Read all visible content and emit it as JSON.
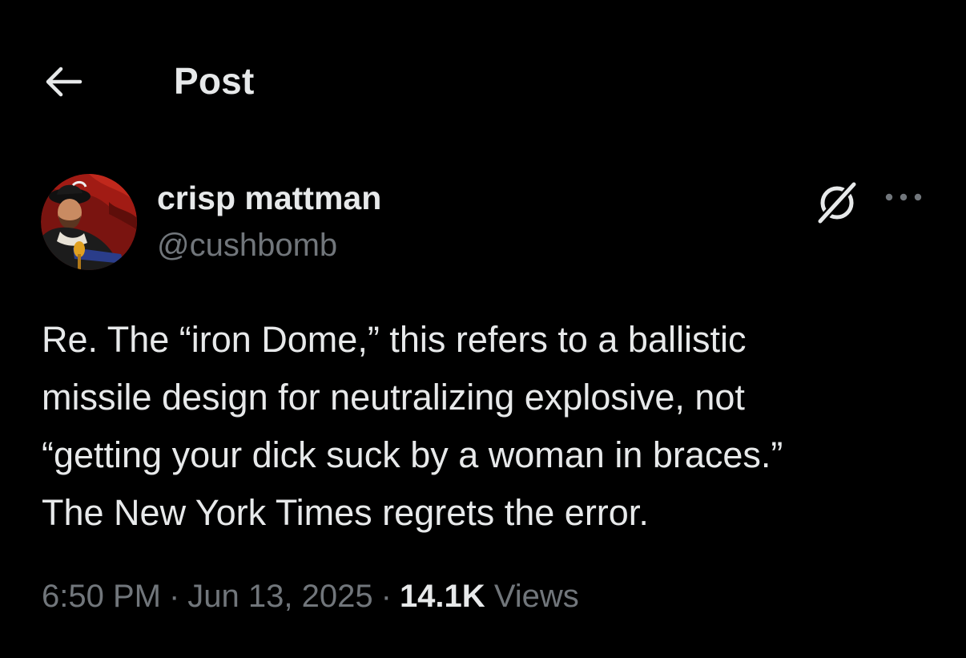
{
  "header": {
    "title": "Post",
    "back_icon": "arrow-left-icon"
  },
  "author": {
    "display_name": "crisp mattman",
    "handle": "@cushbomb",
    "avatar": "avatar-portrait"
  },
  "actions": {
    "grok_icon": "grok-icon",
    "more_icon": "more-horizontal-icon"
  },
  "post": {
    "lines": [
      "Re. The “iron Dome,” this refers to a ballistic",
      "missile design for neutralizing explosive, not",
      "“getting your dick suck by a woman in braces.”",
      "The New York Times regrets the error."
    ]
  },
  "meta": {
    "time": "6:50 PM",
    "separator": "·",
    "date": "Jun 13, 2025",
    "views_count": "14.1K",
    "views_label": "Views"
  },
  "colors": {
    "background": "#000000",
    "text_primary": "#e7e9ea",
    "text_secondary": "#71767b"
  }
}
